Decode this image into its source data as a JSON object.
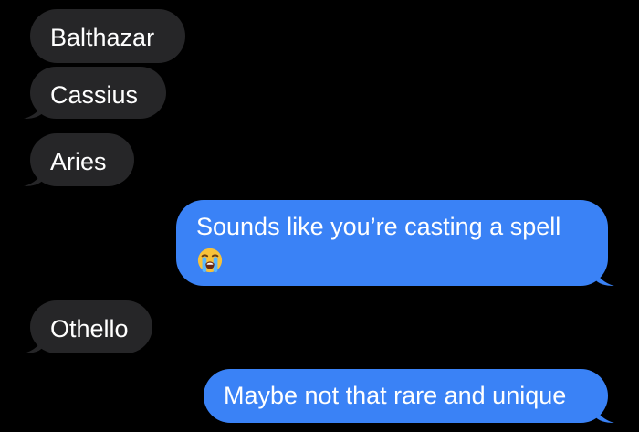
{
  "conversation": {
    "messages": [
      {
        "sender": "contact",
        "text": "Balthazar"
      },
      {
        "sender": "contact",
        "text": "Cassius"
      },
      {
        "sender": "contact",
        "text": "Aries"
      },
      {
        "sender": "me",
        "text": "Sounds like you’re casting a spell",
        "emoji": "loudly-crying-face"
      },
      {
        "sender": "contact",
        "text": "Othello"
      },
      {
        "sender": "me",
        "text": "Maybe not that rare and unique"
      }
    ]
  },
  "colors": {
    "background": "#000000",
    "incoming_bubble": "#262628",
    "outgoing_bubble": "#3a82f6",
    "text": "#ffffff"
  }
}
